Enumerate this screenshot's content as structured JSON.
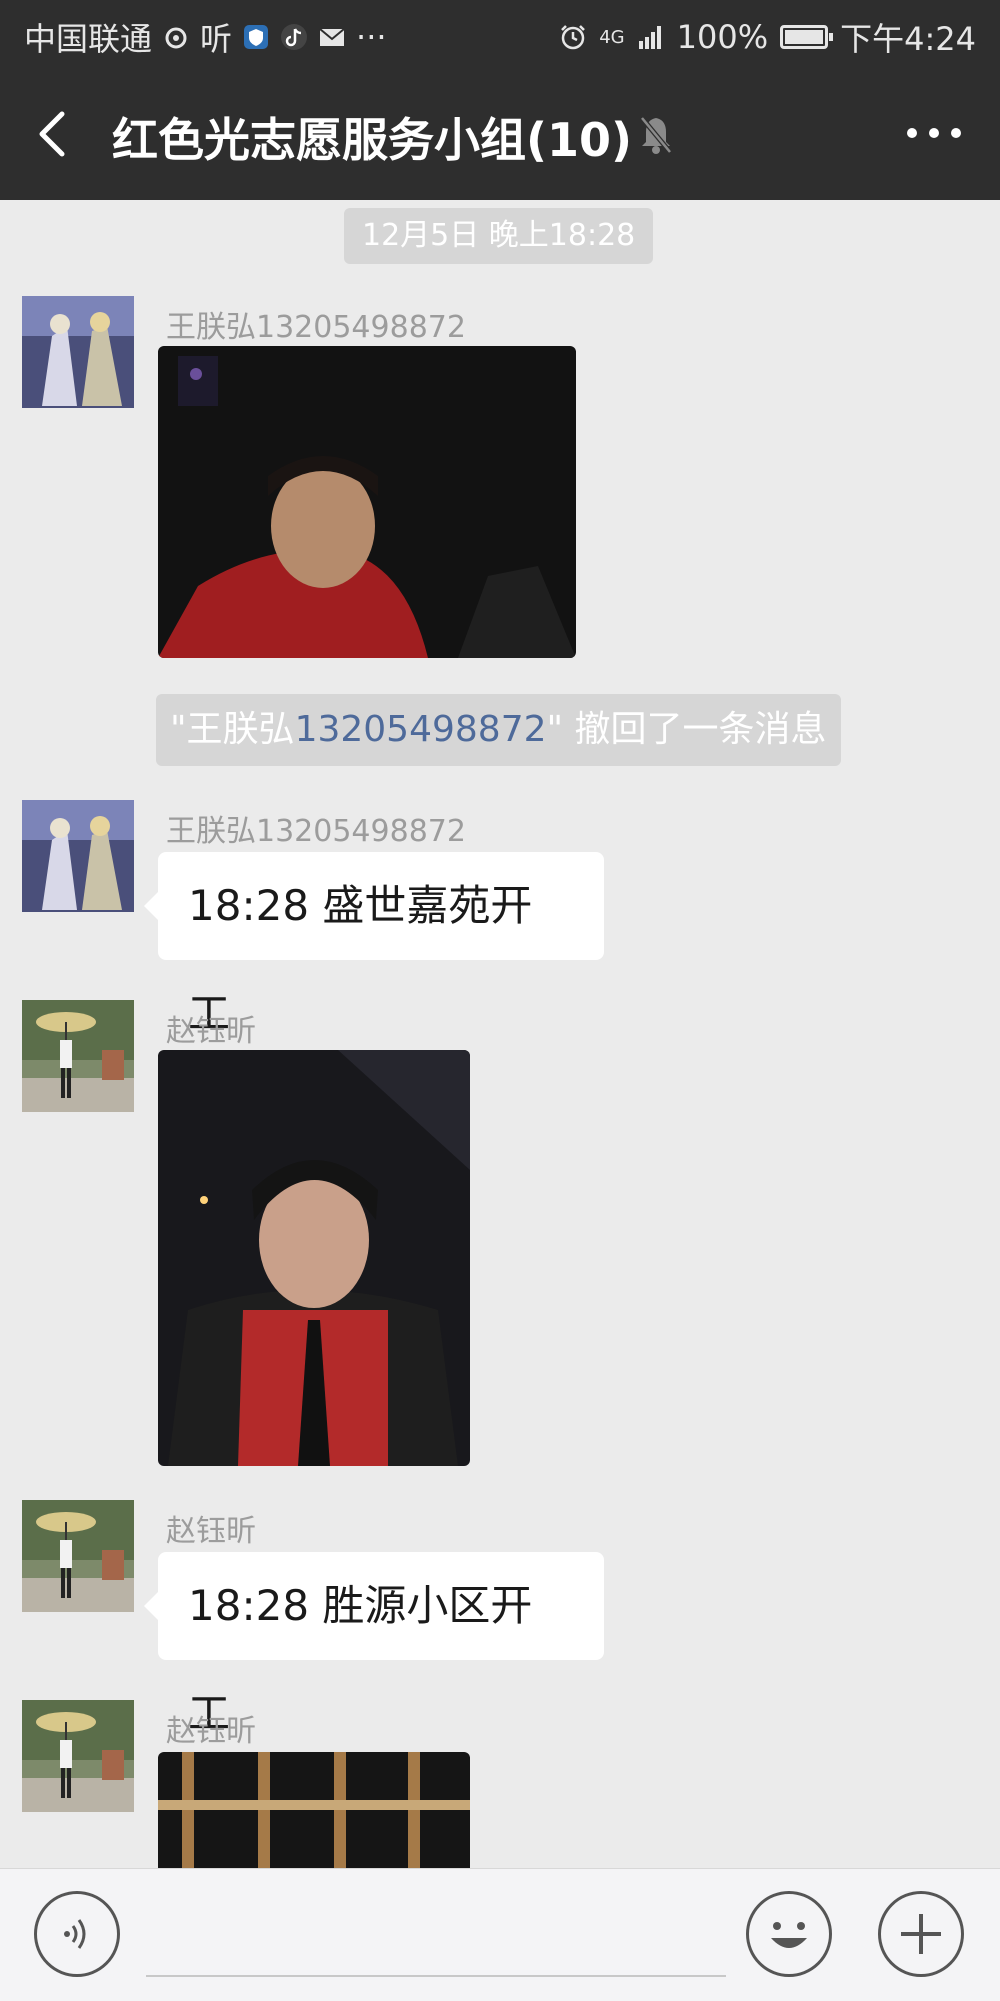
{
  "status_bar": {
    "carrier": "中国联通",
    "app_text": "听",
    "more": "···",
    "network": "4G",
    "battery": "100%",
    "time": "下午4:24"
  },
  "header": {
    "title": "红色光志愿服务小组(10)"
  },
  "chat": {
    "timestamp": "12月5日 晚上18:28",
    "messages": [
      {
        "sender": "王朕弘13205498872",
        "type": "image"
      },
      {
        "sender": "王朕弘13205498872",
        "type": "text",
        "text": "18:28 盛世嘉苑开工"
      },
      {
        "sender": "赵钰昕",
        "type": "image"
      },
      {
        "sender": "赵钰昕",
        "type": "text",
        "text": "18:28 胜源小区开工"
      },
      {
        "sender": "赵钰昕",
        "type": "image"
      }
    ],
    "recall_notice": {
      "prefix": "\"王朕弘",
      "number": "13205498872",
      "suffix": "\" 撤回了一条消息"
    }
  },
  "colors": {
    "header_bg": "#2e2e2e",
    "chat_bg": "#ebebeb",
    "bubble_bg": "#ffffff",
    "sender_text": "#9c9c9c",
    "link_blue": "#4e6a9a"
  },
  "icons": {
    "back": "chevron-left-icon",
    "mute": "bell-off-icon",
    "more": "more-horizontal-icon",
    "voice": "voice-icon",
    "emoji": "smiley-icon",
    "plus": "plus-icon"
  }
}
